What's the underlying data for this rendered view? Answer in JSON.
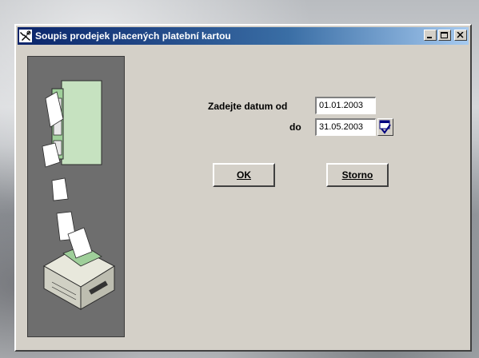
{
  "window": {
    "title": "Soupis prodejek placených platební kartou"
  },
  "form": {
    "date_from_label": "Zadejte datum od",
    "date_to_label": "do",
    "date_from_value": "01.01.2003",
    "date_to_value": "31.05.2003"
  },
  "buttons": {
    "ok_label": "OK",
    "cancel_label": "Storno"
  },
  "icons": {
    "app": "tools-icon",
    "minimize": "minimize-icon",
    "maximize": "maximize-icon",
    "close": "close-icon",
    "calendar": "calendar-icon",
    "illustration": "printer-filing-cabinet-illustration"
  },
  "colors": {
    "titlebar_start": "#0a246a",
    "titlebar_end": "#a6caf0",
    "dialog_bg": "#d4d0c8",
    "side_panel": "#6e6e6e"
  }
}
